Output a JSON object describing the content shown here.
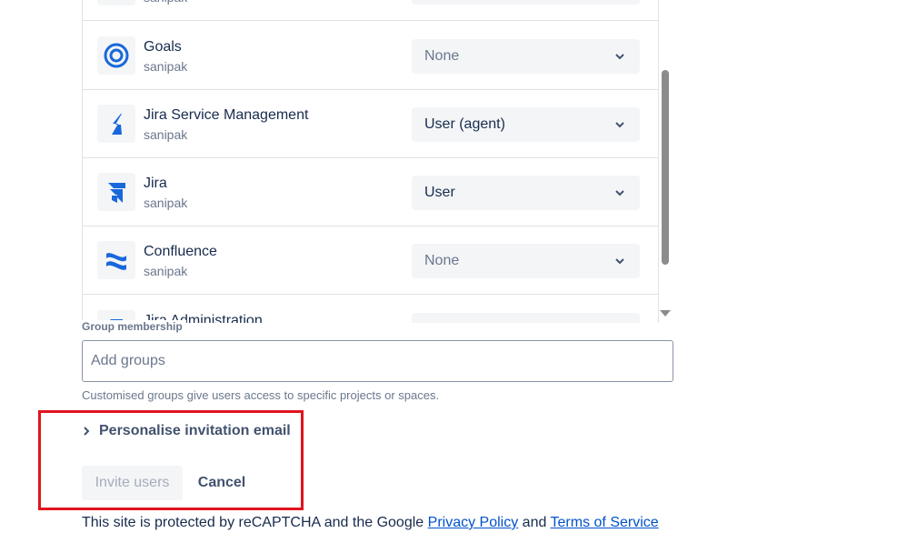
{
  "products": [
    {
      "name": "",
      "site": "sanipak",
      "role": "",
      "icon": "product-icon",
      "dim": false
    },
    {
      "name": "Goals",
      "site": "sanipak",
      "role": "None",
      "icon": "goals-icon",
      "dim": true
    },
    {
      "name": "Jira Service Management",
      "site": "sanipak",
      "role": "User (agent)",
      "icon": "jira-service-management-icon",
      "dim": false
    },
    {
      "name": "Jira",
      "site": "sanipak",
      "role": "User",
      "icon": "jira-icon",
      "dim": false
    },
    {
      "name": "Confluence",
      "site": "sanipak",
      "role": "None",
      "icon": "confluence-icon",
      "dim": true
    },
    {
      "name": "Jira Administration",
      "site": "",
      "role": "",
      "icon": "jira-administration-icon",
      "dim": false
    }
  ],
  "group_membership": {
    "label": "Group membership",
    "placeholder": "Add groups",
    "help": "Customised groups give users access to specific projects or spaces."
  },
  "personalise_label": "Personalise invitation email",
  "actions": {
    "invite": "Invite users",
    "cancel": "Cancel"
  },
  "recaptcha": {
    "prefix": "This site is protected by reCAPTCHA and the Google",
    "privacy": "Privacy Policy",
    "and": "and",
    "terms": "Terms of Service"
  },
  "colors": {
    "brand_blue": "#1868db",
    "highlight": "#e0141e",
    "link": "#0052cc"
  }
}
